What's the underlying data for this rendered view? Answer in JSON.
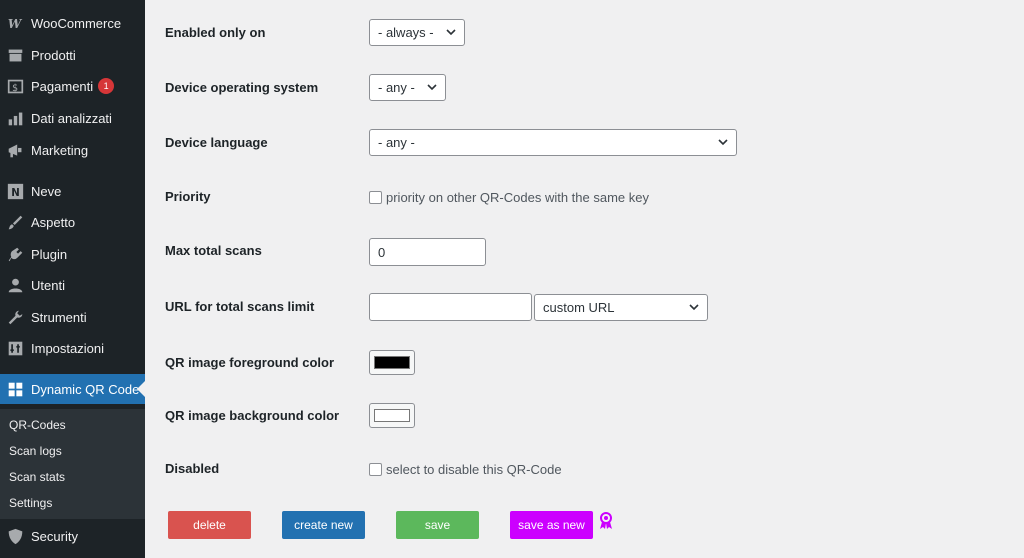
{
  "sidebar": {
    "items": [
      {
        "label": "WooCommerce",
        "icon": "woocommerce-icon"
      },
      {
        "label": "Prodotti",
        "icon": "archive-icon"
      },
      {
        "label": "Pagamenti",
        "icon": "dollar-icon",
        "badge": "1"
      },
      {
        "label": "Dati analizzati",
        "icon": "bar-chart-icon"
      },
      {
        "label": "Marketing",
        "icon": "megaphone-icon"
      },
      {
        "label": "Neve",
        "icon": "neve-logo-icon"
      },
      {
        "label": "Aspetto",
        "icon": "paintbrush-icon"
      },
      {
        "label": "Plugin",
        "icon": "plug-icon"
      },
      {
        "label": "Utenti",
        "icon": "user-icon"
      },
      {
        "label": "Strumenti",
        "icon": "wrench-icon"
      },
      {
        "label": "Impostazioni",
        "icon": "settings-sliders-icon"
      },
      {
        "label": "Dynamic QR Code",
        "icon": "grid-icon",
        "current": true
      },
      {
        "label": "Security",
        "icon": "shield-icon"
      }
    ],
    "submenu": [
      "QR-Codes",
      "Scan logs",
      "Scan stats",
      "Settings"
    ]
  },
  "form": {
    "enabled_only_on": {
      "label": "Enabled only on",
      "value": "- always -"
    },
    "device_os": {
      "label": "Device operating system",
      "value": "- any -"
    },
    "device_language": {
      "label": "Device language",
      "value": "- any -"
    },
    "priority": {
      "label": "Priority",
      "checkbox_label": "priority on other QR-Codes with the same key"
    },
    "max_total_scans": {
      "label": "Max total scans",
      "value": "0"
    },
    "url_limit": {
      "label": "URL for total scans limit",
      "value": "",
      "select_value": "custom URL"
    },
    "fg_color": {
      "label": "QR image foreground color",
      "color": "#000000"
    },
    "bg_color": {
      "label": "QR image background color",
      "color": "#ffffff"
    },
    "disabled": {
      "label": "Disabled",
      "checkbox_label": "select to disable this QR-Code"
    }
  },
  "buttons": {
    "delete": {
      "label": "delete",
      "color": "#d9534f"
    },
    "create_new": {
      "label": "create new",
      "color": "#2271b1"
    },
    "save": {
      "label": "save",
      "color": "#5cb85c"
    },
    "save_as_new": {
      "label": "save as new",
      "color": "#cc00ff"
    }
  },
  "colors": {
    "sidebar_bg": "#1d2327",
    "sidebar_active": "#2271b1",
    "badge": "#d63638"
  }
}
